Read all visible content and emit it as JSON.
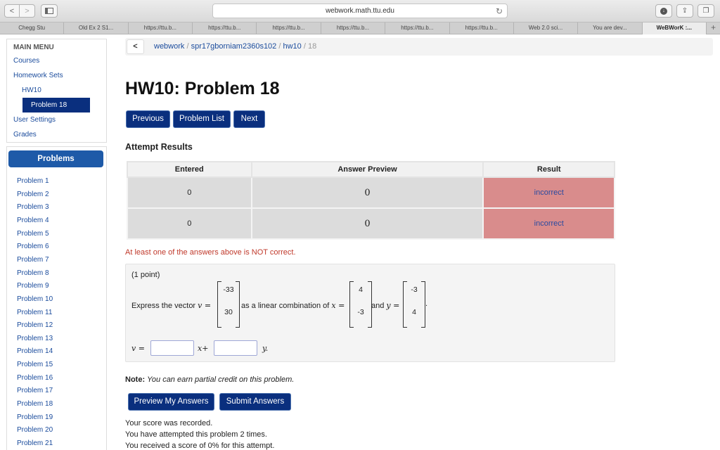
{
  "browser": {
    "url": "webwork.math.ttu.edu",
    "nav_back": "<",
    "nav_forward": ">",
    "reload_glyph": "↻",
    "tabs": [
      {
        "label": "Chegg Stu"
      },
      {
        "label": "Old Ex 2 S1..."
      },
      {
        "label": "https://ttu.b..."
      },
      {
        "label": "https://ttu.b..."
      },
      {
        "label": "https://ttu.b..."
      },
      {
        "label": "https://ttu.b..."
      },
      {
        "label": "https://ttu.b..."
      },
      {
        "label": "https://ttu.b..."
      },
      {
        "label": "Web 2.0 sci..."
      },
      {
        "label": "You are dev..."
      },
      {
        "label": "WeBWorK :..."
      }
    ],
    "new_tab": "+"
  },
  "menu": {
    "title": "MAIN MENU",
    "courses": "Courses",
    "homework_sets": "Homework Sets",
    "hw10": "HW10",
    "problem18": "Problem 18",
    "user_settings": "User Settings",
    "grades": "Grades"
  },
  "problems_panel": {
    "header": "Problems",
    "items": [
      "Problem 1",
      "Problem 2",
      "Problem 3",
      "Problem 4",
      "Problem 5",
      "Problem 6",
      "Problem 7",
      "Problem 8",
      "Problem 9",
      "Problem 10",
      "Problem 11",
      "Problem 12",
      "Problem 13",
      "Problem 14",
      "Problem 15",
      "Problem 16",
      "Problem 17",
      "Problem 18",
      "Problem 19",
      "Problem 20",
      "Problem 21"
    ]
  },
  "breadcrumb": {
    "back": "<",
    "webwork": "webwork",
    "course": "spr17gborniam2360s102",
    "set": "hw10",
    "problem": "18",
    "sep": "/"
  },
  "page_title": "HW10: Problem 18",
  "nav_buttons": {
    "previous": "Previous",
    "problem_list": "Problem List",
    "next": "Next"
  },
  "attempt": {
    "heading": "Attempt Results",
    "headers": [
      "Entered",
      "Answer Preview",
      "Result"
    ],
    "rows": [
      {
        "entered": "0",
        "preview": "0",
        "result": "incorrect"
      },
      {
        "entered": "0",
        "preview": "0",
        "result": "incorrect"
      }
    ],
    "warning": "At least one of the answers above is NOT correct."
  },
  "problem": {
    "points": "(1 point)",
    "express": "Express the vector",
    "v_eq": "v =",
    "v_vals": [
      "-33",
      "30"
    ],
    "as_lin": "as a linear combination of",
    "x_eq": "x =",
    "x_vals": [
      "4",
      "-3"
    ],
    "and": "and",
    "y_eq": "y =",
    "y_vals": [
      "-3",
      "4"
    ],
    "period": ".",
    "answer_lhs": "v =",
    "x_plus": "x+",
    "y_dot": "y."
  },
  "note": {
    "label": "Note:",
    "text": "You can earn partial credit on this problem."
  },
  "actions": {
    "preview": "Preview My Answers",
    "submit": "Submit Answers"
  },
  "status": {
    "recorded": "Your score was recorded.",
    "attempts": "You have attempted this problem 2 times.",
    "score": "You received a score of 0% for this attempt."
  },
  "colors": {
    "primary": "#0a2f7e",
    "link": "#1a4b9c",
    "incorrect_bg": "#d98c8c",
    "warning": "#c0392b",
    "problems_header": "#1e5aa8"
  }
}
